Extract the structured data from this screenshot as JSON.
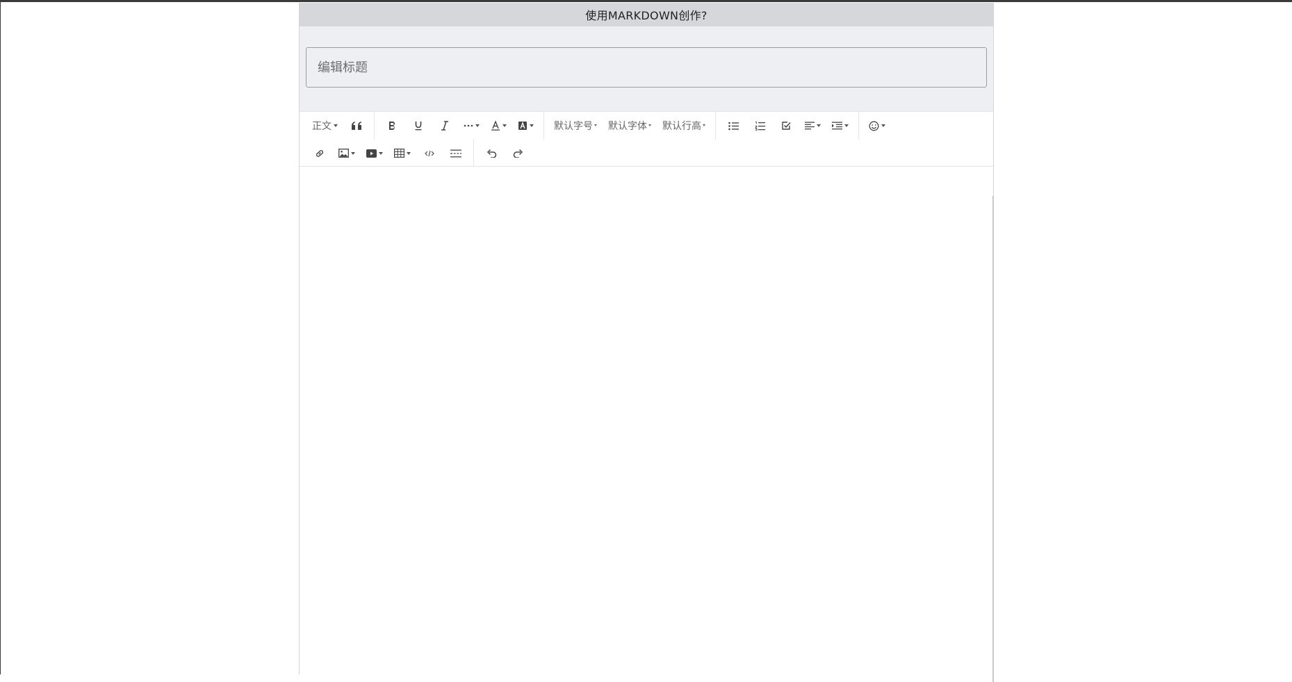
{
  "markdown_toggle": {
    "label": "使用MARKDOWN创作?"
  },
  "title": {
    "placeholder": "编辑标题",
    "value": ""
  },
  "toolbar": {
    "paragraph_label": "正文",
    "font_size_label": "默认字号",
    "font_family_label": "默认字体",
    "line_height_label": "默认行高",
    "icons": [
      "quote-icon",
      "bold-icon",
      "underline-icon",
      "italic-icon",
      "more-styles-icon",
      "font-color-icon",
      "background-color-icon",
      "bullet-list-icon",
      "numbered-list-icon",
      "todo-icon",
      "align-icon",
      "indent-icon",
      "emoji-icon",
      "link-icon",
      "image-icon",
      "video-icon",
      "table-icon",
      "code-block-icon",
      "divider-icon",
      "undo-icon",
      "redo-icon"
    ]
  },
  "editor": {
    "content": ""
  }
}
